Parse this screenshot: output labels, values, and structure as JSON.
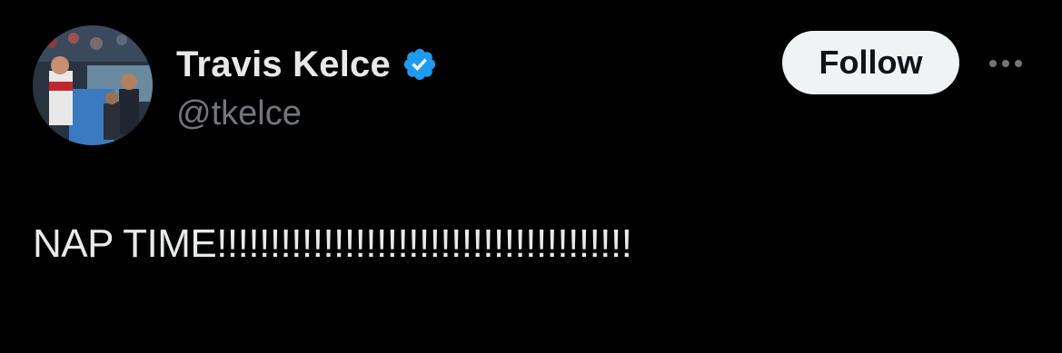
{
  "author": {
    "display_name": "Travis Kelce",
    "handle": "@tkelce",
    "verified": true,
    "verified_color": "#1d9bf0"
  },
  "actions": {
    "follow_label": "Follow",
    "more_icon": "more-horizontal-icon"
  },
  "tweet": {
    "text": "NAP TIME!!!!!!!!!!!!!!!!!!!!!!!!!!!!!!!!!!!!!!!"
  },
  "colors": {
    "background": "#000000",
    "primary_text": "#e7e9ea",
    "secondary_text": "#71767b",
    "follow_button_bg": "#eff3f4",
    "follow_button_text": "#0f1419"
  }
}
